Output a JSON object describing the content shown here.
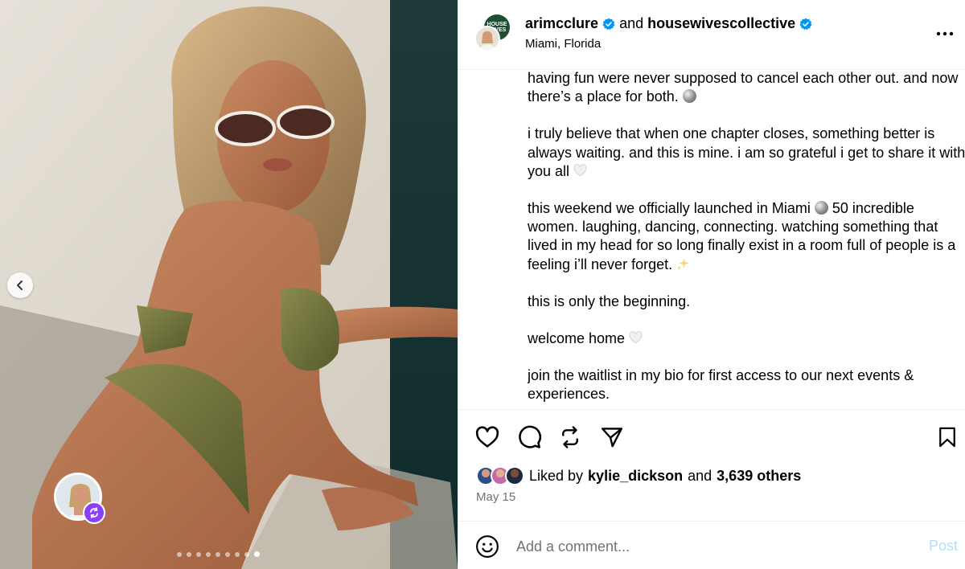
{
  "media": {
    "carousel_total": 9,
    "carousel_active": 9,
    "prev_icon": "chevron-left-icon",
    "tag_badge_icon": "repost-icon"
  },
  "header": {
    "user1": "arimcclure",
    "joiner": "and",
    "user2": "housewivescollective",
    "location": "Miami, Florida",
    "avatar_back_text": "HOUSE WIVES",
    "more_icon": "more-horizontal-icon"
  },
  "caption": {
    "p1": "having fun were never supposed to cancel each other out. and now there’s a place for both.",
    "p2": "i truly believe that when one chapter closes, something better is always waiting. and this is mine. i am so grateful i get to share it with you all",
    "p3a": "this weekend we officially launched in Miami",
    "p3b": "50 incredible women. laughing, dancing, connecting. watching something that lived in my head for so long finally exist in a room full of people is a feeling i’ll never forget.",
    "p4": "this is only the beginning.",
    "p5": "welcome home",
    "p6": "join the waitlist in my bio for first access to our next events & experiences."
  },
  "actions": {
    "like_icon": "heart-icon",
    "comment_icon": "comment-icon",
    "repost_icon": "repost-icon",
    "share_icon": "send-icon",
    "save_icon": "bookmark-icon"
  },
  "likes": {
    "prefix": "Liked by",
    "user": "kylie_dickson",
    "joiner": "and",
    "others": "3,639 others"
  },
  "date": "May 15",
  "comment": {
    "placeholder": "Add a comment...",
    "post_label": "Post",
    "emoji_icon": "smiley-icon"
  },
  "colors": {
    "verified": "#0095f6",
    "post_disabled": "#b2dffc",
    "muted_text": "#737373",
    "repost_badge": "#8a3ffc"
  }
}
